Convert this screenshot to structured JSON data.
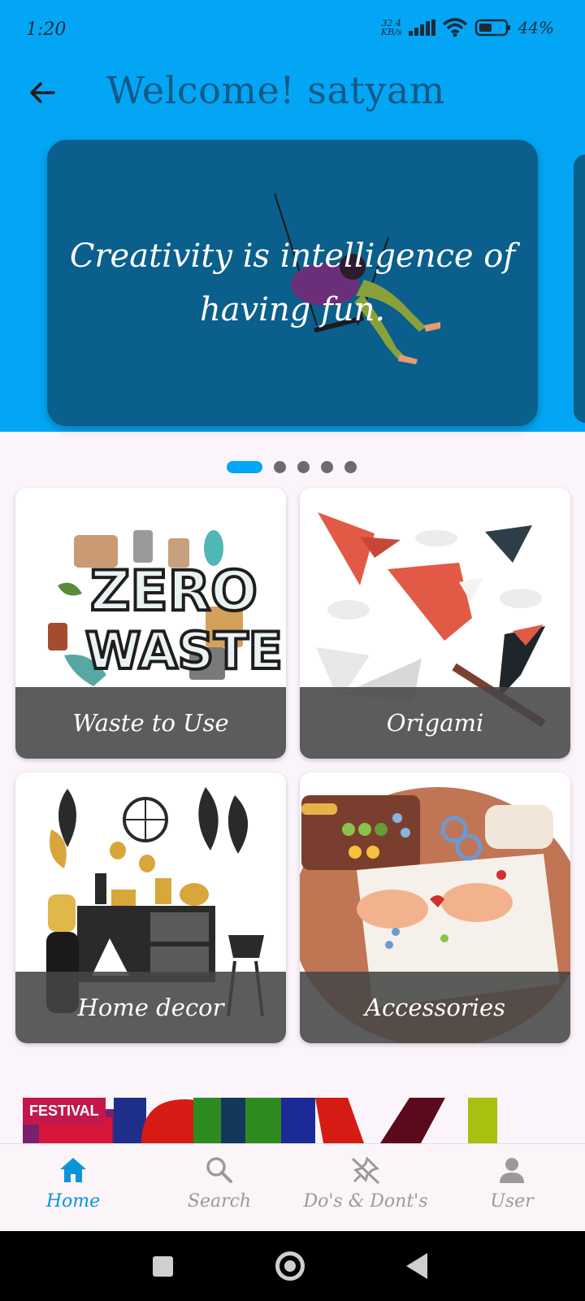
{
  "status_bar": {
    "time": "1:20",
    "speed_value": "32.4",
    "speed_unit": "KB/s",
    "battery": "44%"
  },
  "header": {
    "title": "Welcome! satyam",
    "bg_color": "#03a6f4"
  },
  "banner": {
    "quote": "Creativity is intelligence of having fun.",
    "page_count": 5,
    "active_page": 1
  },
  "categories": [
    {
      "label": "Waste to Use",
      "art_text": [
        "ZERO",
        "WASTE"
      ],
      "icon": "zero-waste-illustration"
    },
    {
      "label": "Origami",
      "icon": "origami-birds-illustration"
    },
    {
      "label": "Home decor",
      "icon": "home-decor-illustration"
    },
    {
      "label": "Accessories",
      "icon": "jewelry-making-illustration"
    }
  ],
  "festival": {
    "tag": "FESTIVAL"
  },
  "bottom_nav": [
    {
      "label": "Home",
      "icon": "home-icon",
      "active": true
    },
    {
      "label": "Search",
      "icon": "search-icon",
      "active": false
    },
    {
      "label": "Do's & Dont's",
      "icon": "no-pin-icon",
      "active": false
    },
    {
      "label": "User",
      "icon": "user-icon",
      "active": false
    }
  ],
  "colors": {
    "accent": "#03a6f4",
    "banner": "#0a5f8c",
    "title": "#0f5a86",
    "active_nav": "#0a95d8"
  }
}
